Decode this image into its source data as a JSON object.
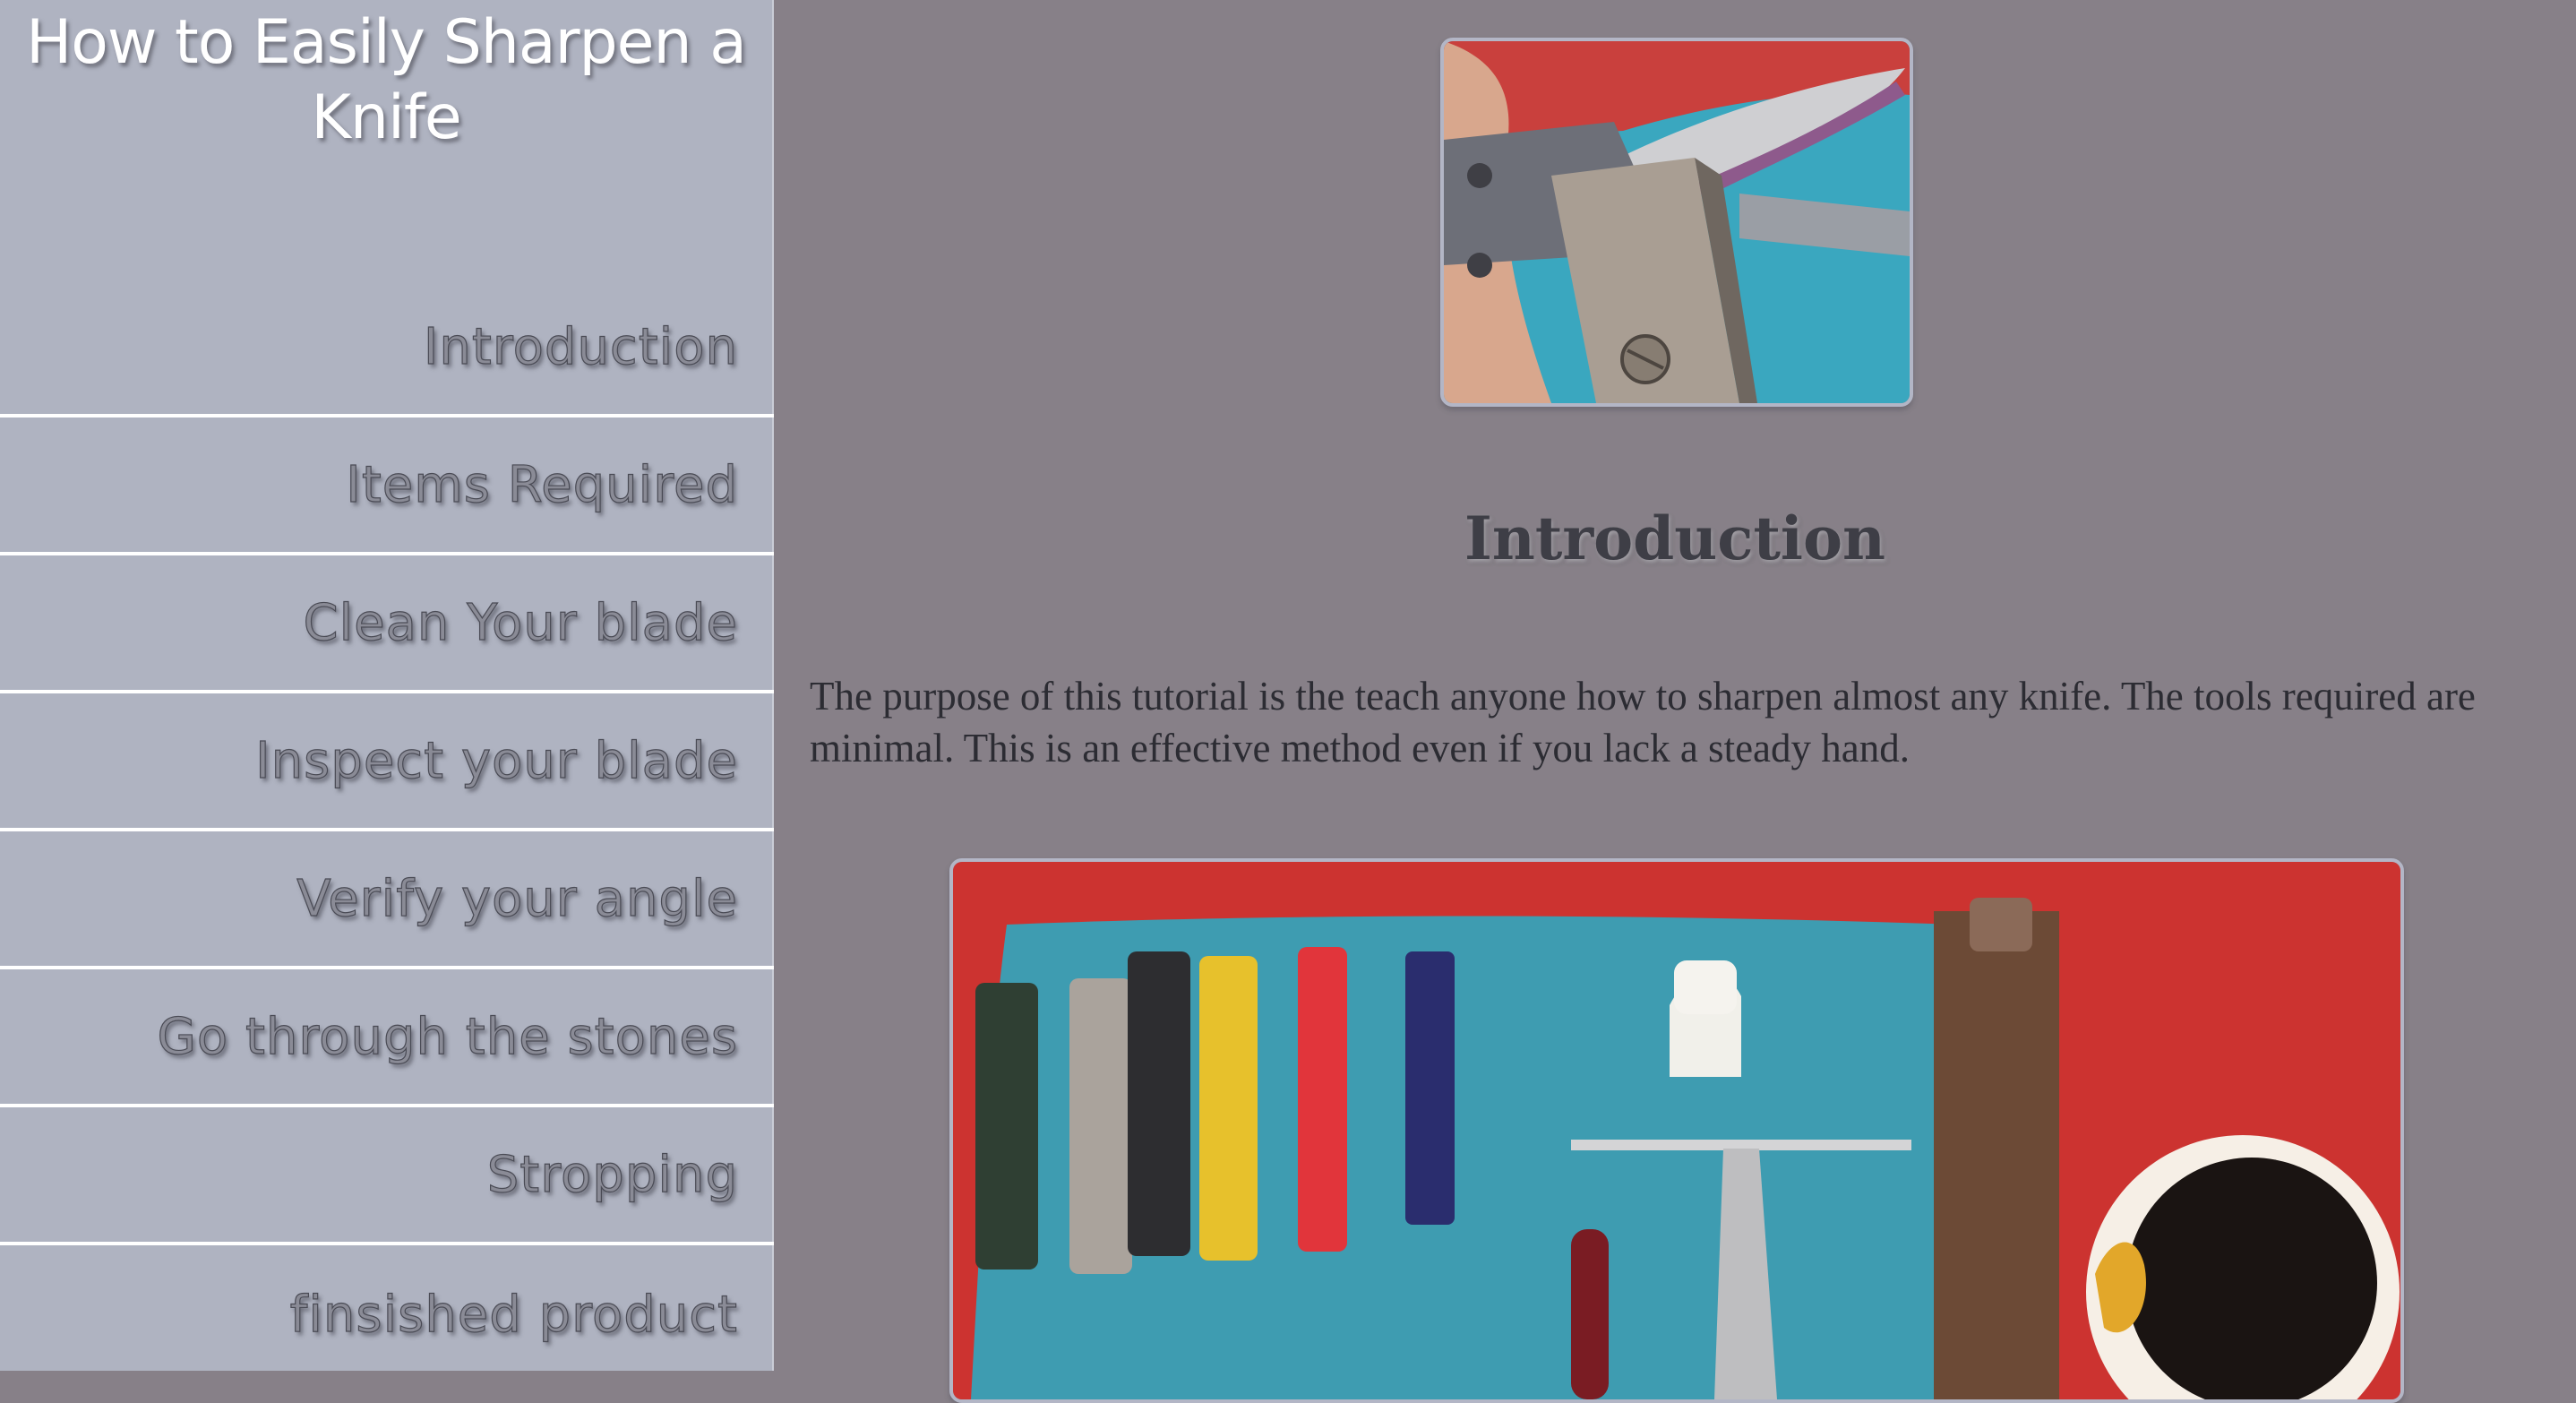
{
  "sidebar": {
    "title": "How to Easily Sharpen a Knife",
    "nav": [
      {
        "label": "Introduction"
      },
      {
        "label": "Items Required"
      },
      {
        "label": "Clean Your blade"
      },
      {
        "label": "Inspect your blade"
      },
      {
        "label": "Verify your angle"
      },
      {
        "label": "Go through the stones"
      },
      {
        "label": "Stropping"
      },
      {
        "label": "finsished product"
      }
    ]
  },
  "main": {
    "heading": "Introduction",
    "paragraph": "The purpose of this tutorial is the teach anyone how to sharpen almost any knife. The tools required are minimal. This is an effective method even if you lack a steady hand."
  },
  "colors": {
    "page_background": "#878088",
    "sidebar_background": "#afb3c1",
    "nav_divider": "#ffffff"
  }
}
